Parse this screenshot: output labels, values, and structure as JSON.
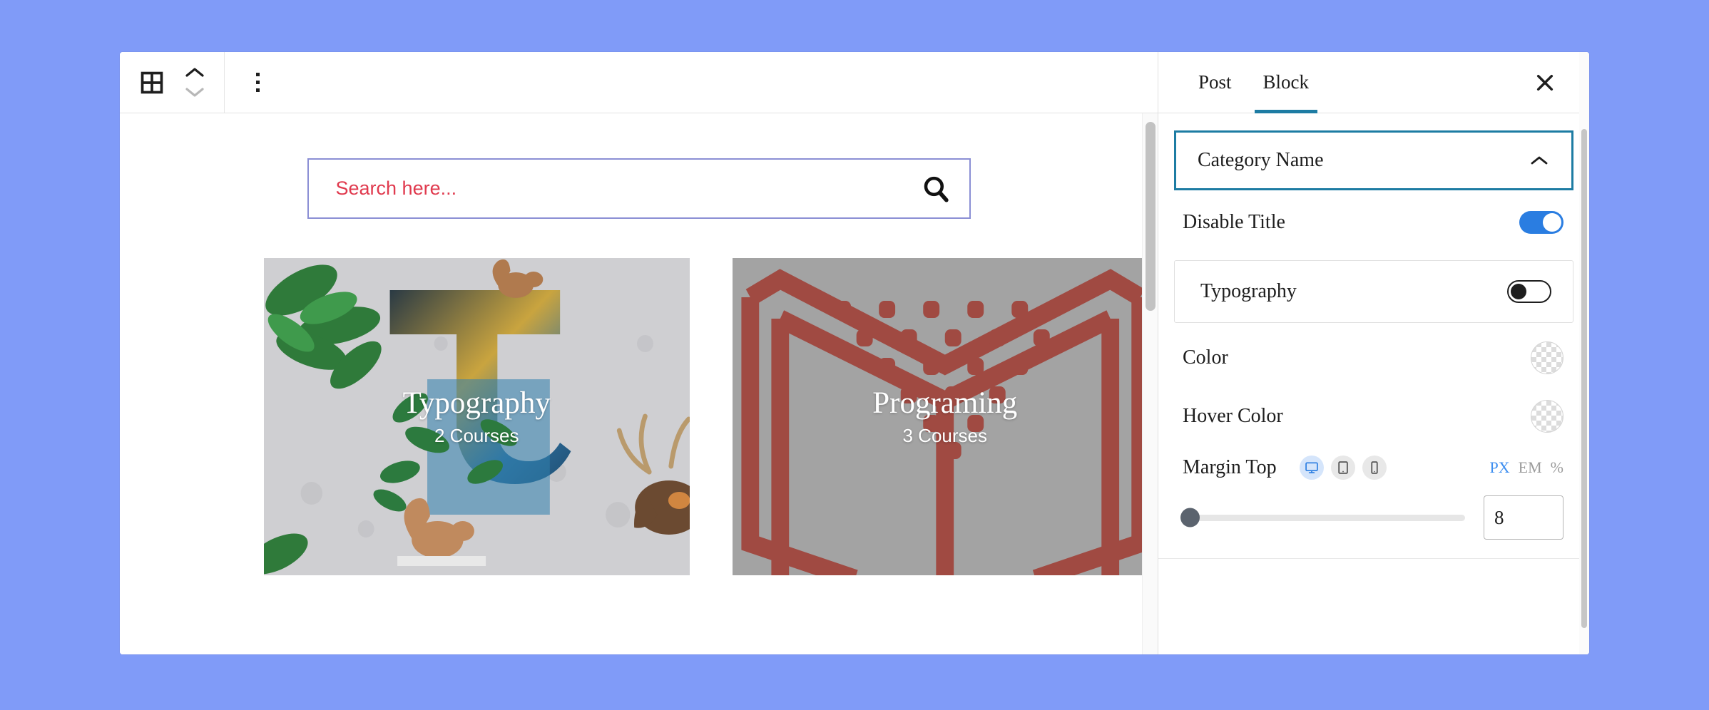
{
  "theme": {
    "page_background": "#809bf8",
    "accent_blue": "#1d7ca3",
    "toggle_on": "#2a7de1",
    "search_text": "#e03a4e",
    "search_border": "#8b8fd4",
    "card_grey": "#a3a3a3",
    "card_red": "#a04a42"
  },
  "toolbar": {
    "block_inserter_icon": "grid-icon",
    "move_up_icon": "chevron-up-icon",
    "move_down_icon": "chevron-down-icon",
    "more_options_icon": "vertical-dots-icon"
  },
  "canvas": {
    "search": {
      "placeholder": "Search here...",
      "value": "",
      "icon": "search-icon"
    },
    "cards": [
      {
        "title": "Typography",
        "subtitle": "2 Courses",
        "art": "botanical-letter-t-illustration"
      },
      {
        "title": "Programing",
        "subtitle": "3 Courses",
        "art": "open-book-icon"
      }
    ]
  },
  "sidebar": {
    "tabs": [
      {
        "label": "Post",
        "active": false
      },
      {
        "label": "Block",
        "active": true
      }
    ],
    "close_icon": "close-icon",
    "panel": {
      "title": "Category Name",
      "collapse_icon": "chevron-up-icon",
      "expanded": true
    },
    "controls": {
      "disable_title": {
        "label": "Disable Title",
        "state": "on"
      },
      "typography": {
        "label": "Typography",
        "state": "off"
      },
      "color": {
        "label": "Color",
        "value": "transparent"
      },
      "hover_color": {
        "label": "Hover Color",
        "value": "transparent"
      },
      "margin_top": {
        "label": "Margin Top",
        "devices": [
          {
            "name": "desktop-icon",
            "active": true
          },
          {
            "name": "tablet-icon",
            "active": false
          },
          {
            "name": "mobile-icon",
            "active": false
          }
        ],
        "units": [
          {
            "label": "PX",
            "active": true
          },
          {
            "label": "EM",
            "active": false
          },
          {
            "label": "%",
            "active": false
          }
        ],
        "value": "8",
        "slider_percent": 0
      }
    }
  }
}
